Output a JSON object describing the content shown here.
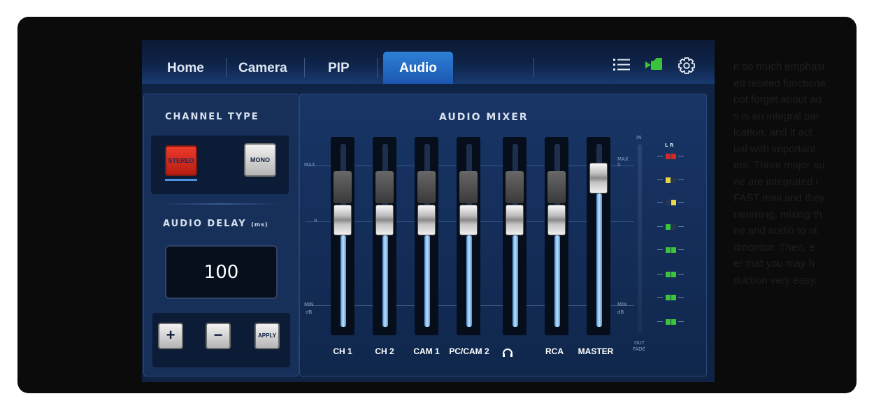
{
  "background_text_lines": [
    "n so much emphasi",
    "ed related functiona",
    "not forget about au",
    "s is an integral par",
    "ication, and it act",
    "ual with important",
    "ers. Three major au",
    "ne are integrated i",
    "FAST mini and they",
    "ramming, mixing th",
    "ne and audio to ot",
    "dmonitor. Then, e",
    "er that you may h",
    "duction very easy."
  ],
  "nav": {
    "tabs": [
      {
        "label": "Home",
        "active": false
      },
      {
        "label": "Camera",
        "active": false
      },
      {
        "label": "PIP",
        "active": false
      },
      {
        "label": "Audio",
        "active": true
      }
    ],
    "icons": [
      "list-icon",
      "camera-record-icon",
      "gear-icon"
    ]
  },
  "channel_type": {
    "heading": "CHANNEL TYPE",
    "stereo_label": "STEREO",
    "mono_label": "MONO",
    "selected": "STEREO"
  },
  "audio_delay": {
    "heading": "AUDIO DELAY",
    "unit": "(ms)",
    "value": "100",
    "plus_label": "+",
    "minus_label": "−",
    "apply_label": "APPLY"
  },
  "mixer": {
    "heading": "AUDIO MIXER",
    "scale": {
      "max": "MAX",
      "zero": "0",
      "min": "MIN",
      "db": "dB"
    },
    "master_scale": {
      "max": "MAX",
      "zero": "0",
      "min": "MIN",
      "db": "dB"
    },
    "in_label": "IN",
    "out_label": "OUT",
    "fade_label": "FADE",
    "channels": [
      {
        "label": "CH 1",
        "level": 0.5
      },
      {
        "label": "CH 2",
        "level": 0.5
      },
      {
        "label": "CAM 1",
        "level": 0.5
      },
      {
        "label": "PC/CAM 2",
        "level": 0.5
      },
      {
        "label": "",
        "icon": "headphones-icon",
        "level": 0.5
      },
      {
        "label": "RCA",
        "level": 0.5
      },
      {
        "label": "MASTER",
        "level": 0.73
      }
    ],
    "vu": {
      "lr_label": "L R",
      "colors": {
        "red": "#d02a22",
        "yellow": "#e6d64a",
        "green": "#3cc43a",
        "off": "#27364f"
      }
    }
  },
  "colors": {
    "accent_tab": "#2e7fd6",
    "panel": "#16305a",
    "stereo_active": "#ec3a2c",
    "record_icon": "#3ac43c"
  }
}
